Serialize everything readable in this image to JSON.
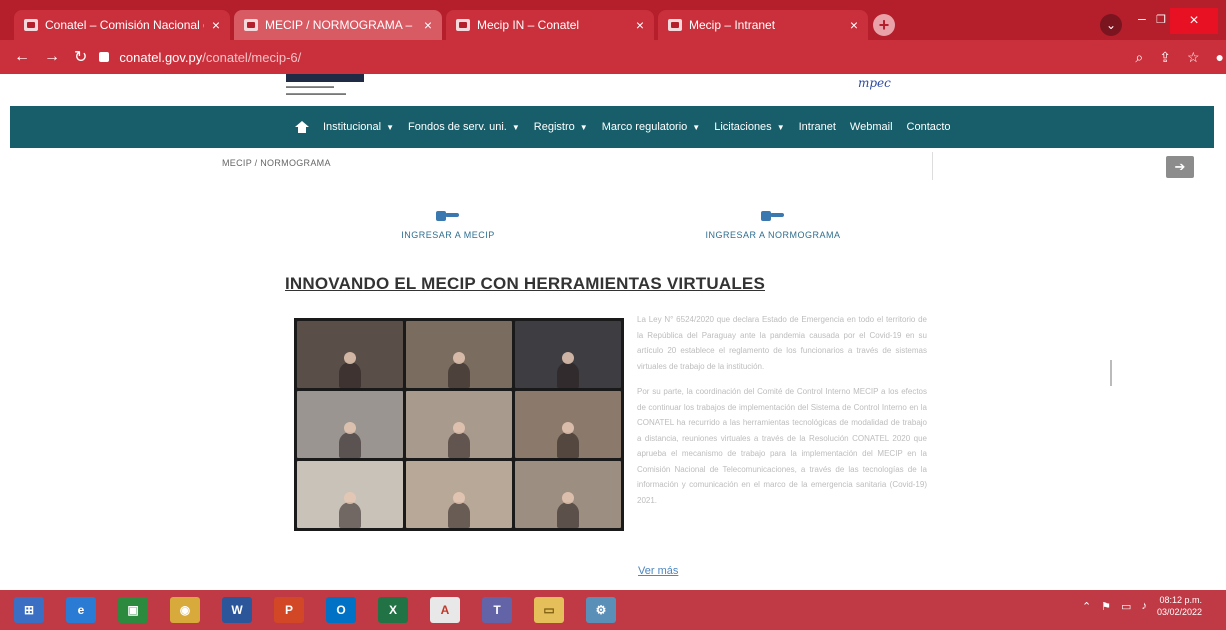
{
  "browser": {
    "tabs": [
      {
        "label": "Conatel – Comisión Nacional de",
        "active": false
      },
      {
        "label": "MECIP / NORMOGRAMA – Conat",
        "active": true
      },
      {
        "label": "Mecip IN – Conatel",
        "active": false
      },
      {
        "label": "Mecip – Intranet",
        "active": false
      }
    ],
    "close_glyph": "×",
    "new_tab_glyph": "+",
    "url_host": "conatel.gov.py",
    "url_path": "/conatel/mecip-6/",
    "window_controls": {
      "minimize": "–",
      "maximize": "❐",
      "close": "×"
    }
  },
  "site": {
    "header_right_text": "mpec",
    "nav": [
      {
        "label": "Institucional",
        "dropdown": true
      },
      {
        "label": "Fondos de serv. uni.",
        "dropdown": true
      },
      {
        "label": "Registro",
        "dropdown": true
      },
      {
        "label": "Marco regulatorio",
        "dropdown": true
      },
      {
        "label": "Licitaciones",
        "dropdown": true
      },
      {
        "label": "Intranet",
        "dropdown": false
      },
      {
        "label": "Webmail",
        "dropdown": false
      },
      {
        "label": "Contacto",
        "dropdown": false
      }
    ],
    "breadcrumb": "MECIP / NORMOGRAMA",
    "next_glyph": "➔",
    "entry_buttons": [
      {
        "label": "INGRESAR A MECIP"
      },
      {
        "label": "INGRESAR A NORMOGRAMA"
      }
    ],
    "article": {
      "title": "INNOVANDO EL MECIP CON HERRAMIENTAS VIRTUALES",
      "paragraphs": [
        "La Ley N° 6524/2020 que declara Estado de Emergencia en todo el territorio de la República del Paraguay ante la pandemia causada por el Covid-19 en su artículo 20 establece el reglamento de los funcionarios a través de sistemas virtuales de trabajo de la institución.",
        "Por su parte, la coordinación del Comité de Control Interno MECIP a los efectos de continuar los trabajos de implementación del Sistema de Control Interno en la CONATEL ha recurrido a las herramientas tecnológicas de modalidad de trabajo a distancia, reuniones virtuales a través de la Resolución CONATEL 2020 que aprueba el mecanismo de trabajo para la implementación del MECIP en la Comisión Nacional de Telecomunicaciones, a través de las tecnologías de la información y comunicación en el marco de la emergencia sanitaria (Covid-19) 2021."
      ],
      "more_link": "Ver más"
    }
  },
  "taskbar": {
    "apps": [
      {
        "name": "windows-start",
        "glyph": "⊞",
        "color": "#3a6fc4"
      },
      {
        "name": "internet-explorer",
        "glyph": "e",
        "color": "#2a7bd3"
      },
      {
        "name": "store",
        "glyph": "▣",
        "color": "#2b8a3e"
      },
      {
        "name": "chrome",
        "glyph": "◉",
        "color": "#d8a93b"
      },
      {
        "name": "word",
        "glyph": "W",
        "color": "#2b579a"
      },
      {
        "name": "powerpoint",
        "glyph": "P",
        "color": "#d24726"
      },
      {
        "name": "outlook",
        "glyph": "O",
        "color": "#0072c6"
      },
      {
        "name": "excel",
        "glyph": "X",
        "color": "#217346"
      },
      {
        "name": "acrobat",
        "glyph": "A",
        "color": "#e8e8e8"
      },
      {
        "name": "teams",
        "glyph": "T",
        "color": "#6264a7"
      },
      {
        "name": "file-explorer",
        "glyph": "▭",
        "color": "#e5c05a"
      },
      {
        "name": "network-settings",
        "glyph": "⚙",
        "color": "#5a8fb8"
      }
    ],
    "time": "08:12 p.m.",
    "date": "03/02/2022"
  },
  "colors": {
    "browser_red": "#b41f2b",
    "nav_teal": "#175e6a",
    "taskbar": "#c03a46",
    "link_blue": "#4d86c0"
  }
}
